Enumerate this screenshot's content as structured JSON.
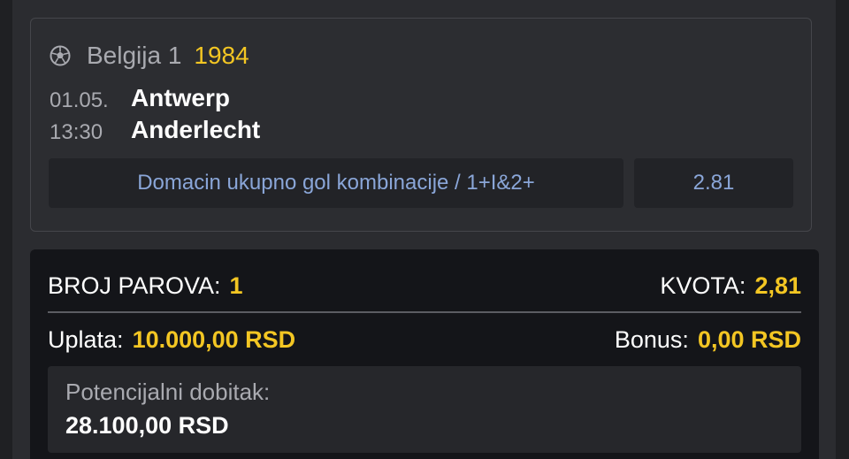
{
  "match": {
    "sport_icon": "soccer-ball-icon",
    "league_name": "Belgija 1",
    "league_code": "1984",
    "date": "01.05.",
    "time": "13:30",
    "home_team": "Antwerp",
    "away_team": "Anderlecht",
    "bet_label": "Domacin ukupno gol kombinacije / 1+I&2+",
    "bet_odd": "2.81"
  },
  "summary": {
    "pairs_label": "BROJ PAROVA:",
    "pairs_value": "1",
    "odds_label": "KVOTA:",
    "odds_value": "2,81",
    "stake_label": "Uplata:",
    "stake_value": "10.000,00 RSD",
    "bonus_label": "Bonus:",
    "bonus_value": "0,00 RSD",
    "win_label": "Potencijalni dobitak:",
    "win_value": "28.100,00 RSD"
  },
  "colors": {
    "accent": "#f3c623",
    "link": "#8aa6d8",
    "background": "#2b2c30",
    "panel": "#141519"
  }
}
